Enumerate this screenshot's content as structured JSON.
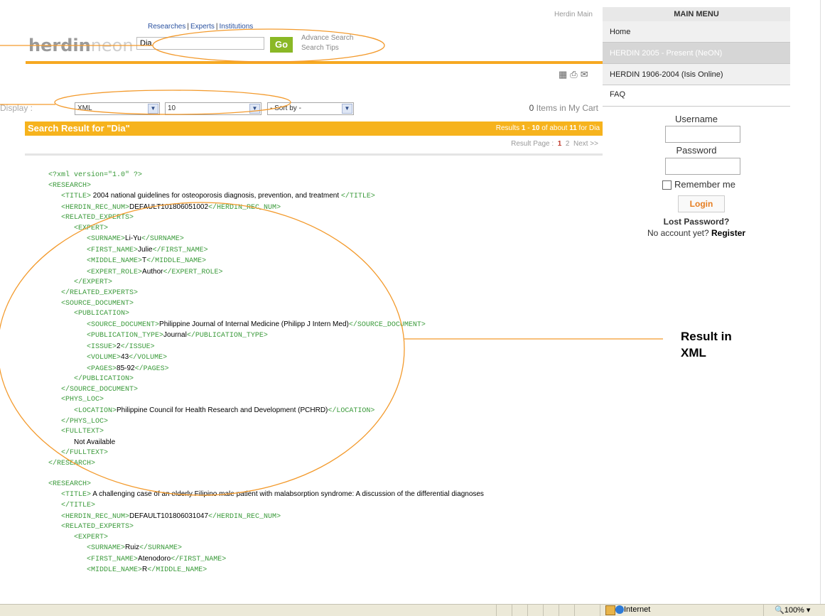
{
  "header": {
    "logo_part1": "herdin",
    "logo_part2": "neon",
    "top_links": [
      "Researches",
      "Experts",
      "Institutions"
    ],
    "herdin_main": "Herdin Main",
    "search_value": "Dia",
    "go_label": "Go",
    "advance_search": "Advance Search",
    "search_tips": "Search Tips"
  },
  "toolbar": {
    "display_label": "Display :",
    "format_value": "XML",
    "count_value": "10",
    "sort_value": "- Sort by -",
    "cart_count": "0",
    "cart_text": "Items in My Cart"
  },
  "results": {
    "title": "Search Result for  \"Dia\"",
    "summary_prefix": "Results",
    "start": "1",
    "end": "10",
    "of_about": "of about",
    "total": "11",
    "for_term": "for Dia",
    "page_label": "Result Page :",
    "pages": [
      "1",
      "2"
    ],
    "next": "Next >>"
  },
  "xml": {
    "decl": "<?xml version=\"1.0\" ?>",
    "r1_title": " 2004 national guidelines for osteoporosis diagnosis, prevention, and treatment ",
    "r1_recnum": "DEFAULT101806051002",
    "r1_surname": "Li-Yu",
    "r1_first": "Julie",
    "r1_middle": "T",
    "r1_role": "Author",
    "r1_source": "Philippine Journal of Internal Medicine (Philipp J Intern Med)",
    "r1_pubtype": "Journal",
    "r1_issue": "2",
    "r1_volume": "43",
    "r1_pages": "85-92",
    "r1_location": "Philippine Council for Health Research and Development (PCHRD)",
    "r1_fulltext": "Not Available",
    "r2_title": " A challenging case of an elderly Filipino male patient with malabsorption syndrome: A discussion of the differential diagnoses",
    "r2_recnum": "DEFAULT101806031047",
    "r2_surname": "Ruiz",
    "r2_first": "Atenodoro",
    "r2_middle": "R"
  },
  "sidebar": {
    "main_menu": "MAIN MENU",
    "items": [
      "Home",
      "HERDIN 2005 - Present (NeON)",
      "HERDIN 1906-2004 (Isis Online)",
      "FAQ"
    ],
    "username_label": "Username",
    "password_label": "Password",
    "remember_label": "Remember me",
    "login_label": "Login",
    "lost_password": "Lost Password?",
    "no_account": "No account yet?",
    "register": "Register"
  },
  "annotation": {
    "line1": "Result in",
    "line2": "XML"
  },
  "statusbar": {
    "zone": "Internet",
    "zoom": "100%"
  }
}
